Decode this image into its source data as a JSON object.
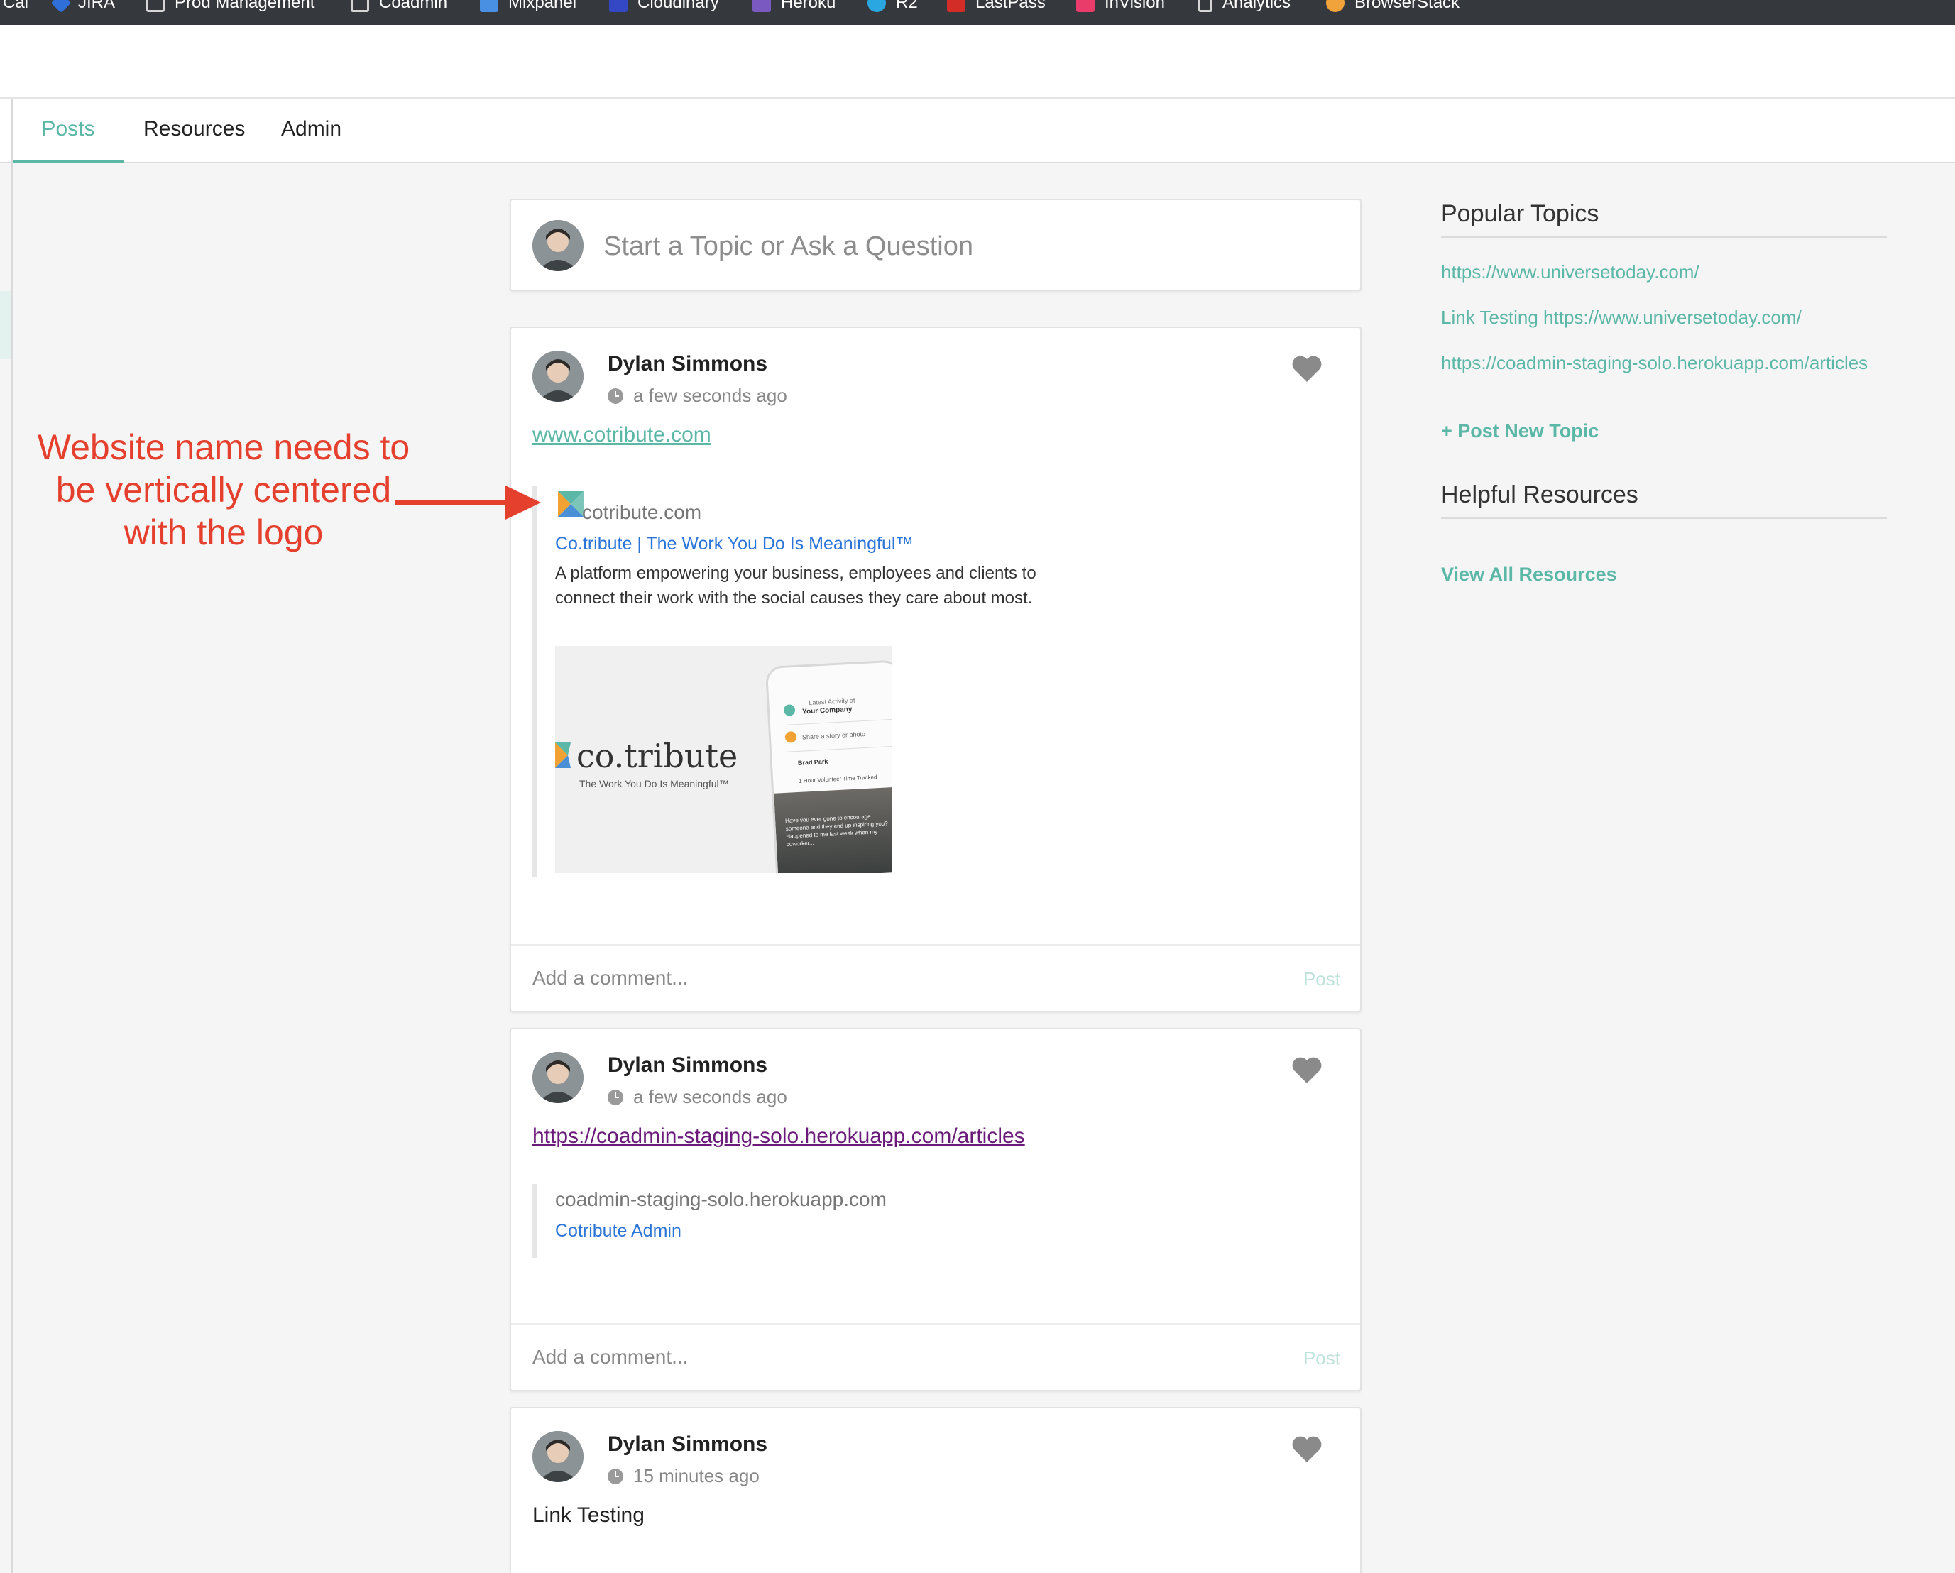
{
  "bookmarks": [
    {
      "label": "Cal",
      "icon": "calendar-icon",
      "color": "#35393d"
    },
    {
      "label": "JIRA",
      "icon": "jira-icon",
      "color": "#2f6fd9"
    },
    {
      "label": "Prod Management",
      "icon": "folder-icon",
      "color": "#d5d5d5"
    },
    {
      "label": "Coadmin",
      "icon": "folder-icon",
      "color": "#d5d5d5"
    },
    {
      "label": "Mixpanel",
      "icon": "mixpanel-icon",
      "color": "#4a90e2"
    },
    {
      "label": "Cloudinary",
      "icon": "cloudinary-icon",
      "color": "#3448c5"
    },
    {
      "label": "Heroku",
      "icon": "heroku-icon",
      "color": "#7a5ac0"
    },
    {
      "label": "R2",
      "icon": "snowflake-icon",
      "color": "#2aa7e0"
    },
    {
      "label": "LastPass",
      "icon": "lastpass-icon",
      "color": "#d32d27"
    },
    {
      "label": "InVision",
      "icon": "invision-icon",
      "color": "#ea3c6b"
    },
    {
      "label": "Analytics",
      "icon": "page-icon",
      "color": "#35393d"
    },
    {
      "label": "BrowserStack",
      "icon": "browserstack-icon",
      "color": "#f0a33a"
    }
  ],
  "nav": {
    "posts": "Posts",
    "resources": "Resources",
    "admin": "Admin"
  },
  "composer": {
    "placeholder": "Start a Topic or Ask a Question"
  },
  "posts": [
    {
      "author": "Dylan Simmons",
      "time": "a few seconds ago",
      "link": "www.cotribute.com",
      "preview": {
        "site": "cotribute.com",
        "title": "Co.tribute | The Work You Do Is Meaningful™",
        "description": "A platform empowering your business, employees and clients to connect their work with the social causes they care about most.",
        "image_wordmark": "co.tribute",
        "image_tagline": "The Work You Do Is Meaningful™",
        "phone": {
          "line1": "Latest Activity at",
          "line2": "Your Company",
          "share": "Share a story or photo",
          "user": "Brad Park",
          "caption": "1 Hour Volunteer Time Tracked",
          "quote": "Have you ever gone to encourage someone and they end up inspiring you? Happened to me last week when my coworker..."
        }
      },
      "comment_placeholder": "Add a comment...",
      "comment_post": "Post"
    },
    {
      "author": "Dylan Simmons",
      "time": "a few seconds ago",
      "link": "https://coadmin-staging-solo.herokuapp.com/articles",
      "preview": {
        "site": "coadmin-staging-solo.herokuapp.com",
        "title": "Cotribute Admin"
      },
      "comment_placeholder": "Add a comment...",
      "comment_post": "Post"
    },
    {
      "author": "Dylan Simmons",
      "time": "15 minutes ago",
      "text": "Link Testing"
    }
  ],
  "sidebar": {
    "popular_heading": "Popular Topics",
    "topics": [
      "https://www.universetoday.com/",
      "Link Testing https://www.universetoday.com/",
      "https://coadmin-staging-solo.herokuapp.com/articles"
    ],
    "post_new_topic": "+ Post New Topic",
    "resources_heading": "Helpful Resources",
    "view_all": "View All Resources"
  },
  "annotation": {
    "text": "Website name needs to be vertically centered with the logo"
  },
  "colors": {
    "accent": "#5bb7a6",
    "preview_title": "#2b74d8",
    "annotation": "#e5402e",
    "visited_link": "#6a1b7a"
  }
}
